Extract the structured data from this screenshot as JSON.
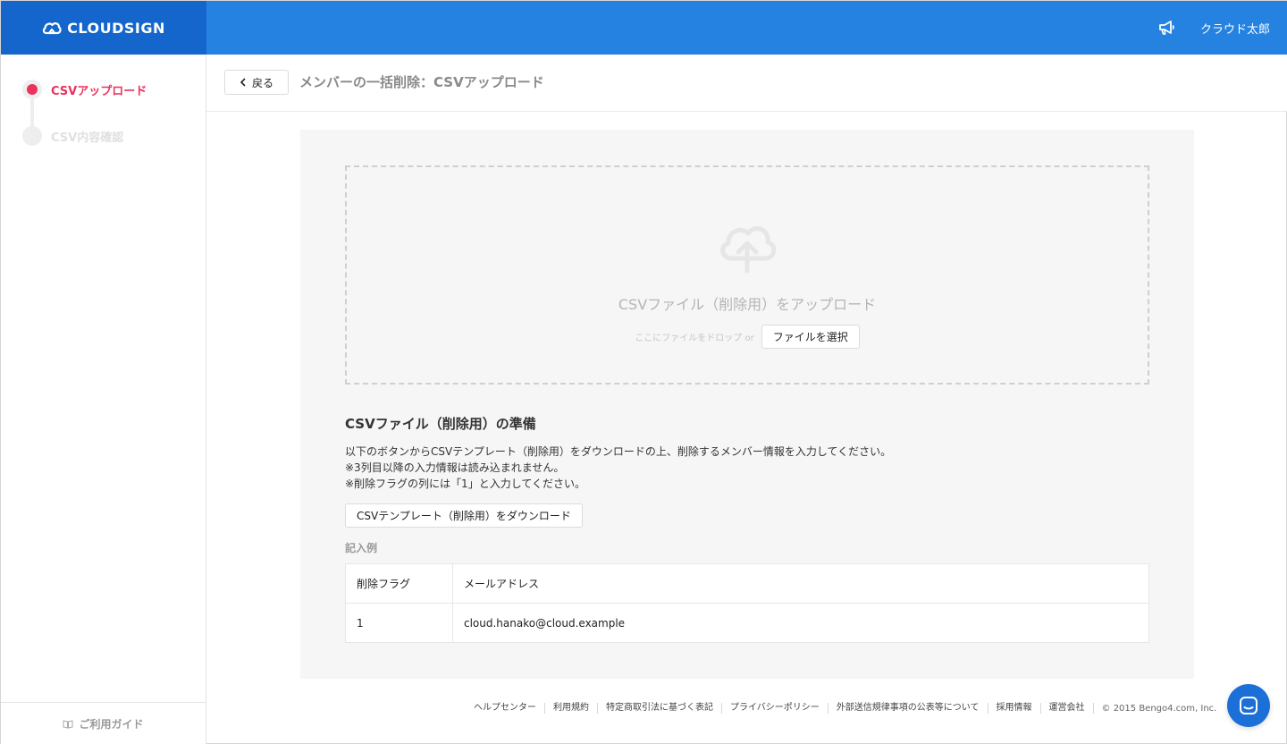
{
  "header": {
    "brand": "CLOUDSIGN",
    "user_name": "クラウド太郎",
    "bg_color": "#2582e0",
    "brand_bg_color": "#1466cc"
  },
  "sidebar": {
    "steps": [
      {
        "label": "CSVアップロード",
        "state": "active"
      },
      {
        "label": "CSV内容確認",
        "state": "inactive"
      }
    ],
    "guide_label": "ご利用ガイド",
    "accent_color": "#e8335c"
  },
  "topbar": {
    "back_label": "戻る",
    "title": "メンバーの一括削除：CSVアップロード"
  },
  "dropzone": {
    "title": "CSVファイル（削除用）をアップロード",
    "hint": "ここにファイルをドロップ or",
    "select_label": "ファイルを選択"
  },
  "prep": {
    "title": "CSVファイル（削除用）の準備",
    "lines": [
      "以下のボタンからCSVテンプレート（削除用）をダウンロードの上、削除するメンバー情報を入力してください。",
      "※3列目以降の入力情報は読み込まれません。",
      "※削除フラグの列には「1」と入力してください。"
    ],
    "download_label": "CSVテンプレート（削除用）をダウンロード",
    "example_label": "記入例"
  },
  "example_table": {
    "headers": [
      "削除フラグ",
      "メールアドレス"
    ],
    "rows": [
      [
        "1",
        "cloud.hanako@cloud.example"
      ]
    ]
  },
  "footer": {
    "links": [
      "ヘルプセンター",
      "利用規約",
      "特定商取引法に基づく表記",
      "プライバシーポリシー",
      "外部送信規律事項の公表等について",
      "採用情報",
      "運営会社"
    ],
    "copyright": "© 2015 Bengo4.com, Inc."
  },
  "icons": {
    "brand": "cloud-logo-icon",
    "notifications": "megaphone-icon",
    "back": "chevron-left-icon",
    "upload": "cloud-upload-icon",
    "guide": "book-icon",
    "chat": "chat-icon"
  }
}
